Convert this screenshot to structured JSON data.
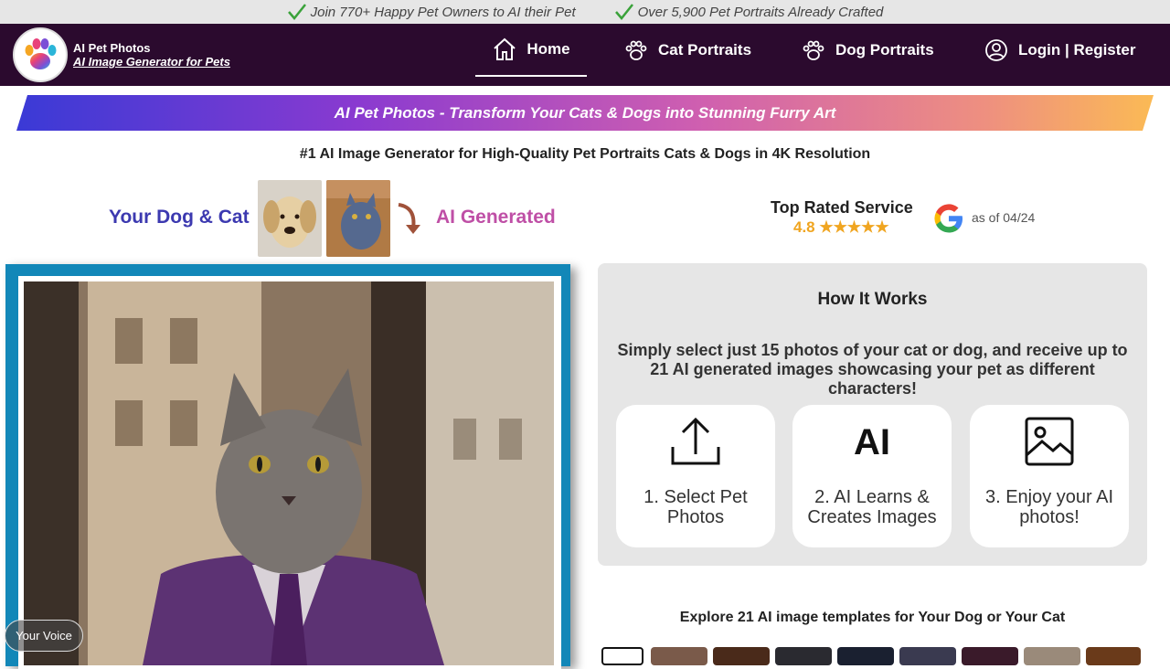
{
  "topbar": {
    "note1": "Join 770+ Happy Pet Owners to AI their Pet",
    "note2": "Over 5,900 Pet Portraits Already Crafted"
  },
  "brand": {
    "name": "AI Pet Photos",
    "tagline": "AI Image Generator for Pets"
  },
  "nav": {
    "home": "Home",
    "cat": "Cat Portraits",
    "dog": "Dog Portraits",
    "login": "Login | Register"
  },
  "banner": "AI Pet Photos - Transform Your Cats & Dogs into Stunning Furry Art",
  "subtitle": "#1 AI Image Generator for High-Quality Pet Portraits Cats & Dogs in 4K Resolution",
  "compare": {
    "left": "Your Dog & Cat",
    "right": "AI Generated"
  },
  "rating": {
    "title": "Top Rated Service",
    "value": "4.8 ★★★★★",
    "as_of": "as of 04/24"
  },
  "how": {
    "title": "How It Works",
    "desc": "Simply select just 15 photos of your cat or dog, and receive up to 21 AI generated images showcasing your pet as different characters!",
    "steps": [
      {
        "label": "1. Select Pet Photos",
        "icon": "upload-icon"
      },
      {
        "label": "2. AI Learns & Creates Images",
        "icon": "ai-icon"
      },
      {
        "label": "3. Enjoy your AI photos!",
        "icon": "image-icon"
      }
    ]
  },
  "explore": "Explore 21 AI image templates for Your Dog or Your Cat",
  "voice": "Your Voice",
  "colors": {
    "navbar": "#2b0a2e",
    "frame": "#1287b8",
    "your_pet": "#3c39b0",
    "ai_generated": "#bf4fa6",
    "stars": "#f0a520"
  }
}
